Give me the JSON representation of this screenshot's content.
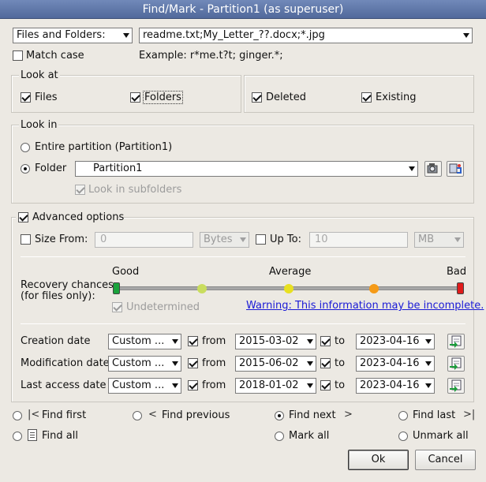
{
  "window": {
    "title": "Find/Mark - Partition1 (as superuser)"
  },
  "search": {
    "type_value": "Files and Folders:",
    "pattern_value": "readme.txt;My_Letter_??.docx;*.jpg",
    "match_case_label": "Match case",
    "match_case_checked": false,
    "example_text": "Example: r*me.t?t; ginger.*;"
  },
  "look_at": {
    "title": "Look at",
    "files_label": "Files",
    "folders_label": "Folders",
    "deleted_label": "Deleted",
    "existing_label": "Existing",
    "files_checked": true,
    "folders_checked": true,
    "deleted_checked": true,
    "existing_checked": true
  },
  "look_in": {
    "title": "Look in",
    "entire_partition_label": "Entire partition (Partition1)",
    "folder_label": "Folder",
    "folder_value": "Partition1",
    "subfolders_label": "Look in subfolders",
    "selected": "folder"
  },
  "advanced": {
    "title": "Advanced options",
    "checked": true,
    "size_from_label": "Size From:",
    "size_from_value": "0",
    "size_from_unit": "Bytes",
    "up_to_label": "Up To:",
    "up_to_value": "10",
    "up_to_unit": "MB",
    "recovery_label_line1": "Recovery chances",
    "recovery_label_line2": "(for files only):",
    "scale_good": "Good",
    "scale_average": "Average",
    "scale_bad": "Bad",
    "recovery_level": 1.0,
    "undetermined_label": "Undetermined",
    "warning_link": "Warning: This information may be incomplete.",
    "colors": {
      "green": "#1aa33c",
      "lightgreen": "#c9dd5e",
      "yellow": "#e8e021",
      "orange": "#f59a17",
      "red": "#e01b1b"
    }
  },
  "dates": {
    "from_label": "from",
    "to_label": "to",
    "rows": [
      {
        "label": "Creation date",
        "mode": "Custom ...",
        "from": "2015-03-02",
        "to": "2023-04-16"
      },
      {
        "label": "Modification date",
        "mode": "Custom ...",
        "from": "2015-06-02",
        "to": "2023-04-16"
      },
      {
        "label": "Last access date",
        "mode": "Custom ...",
        "from": "2018-01-02",
        "to": "2023-04-16"
      }
    ]
  },
  "actions": {
    "find_first": "Find first",
    "find_previous": "Find previous",
    "find_next": "Find next",
    "find_last": "Find last",
    "find_all": "Find all",
    "mark_all": "Mark all",
    "unmark_all": "Unmark all",
    "selected": "find_next"
  },
  "buttons": {
    "ok": "Ok",
    "cancel": "Cancel"
  }
}
